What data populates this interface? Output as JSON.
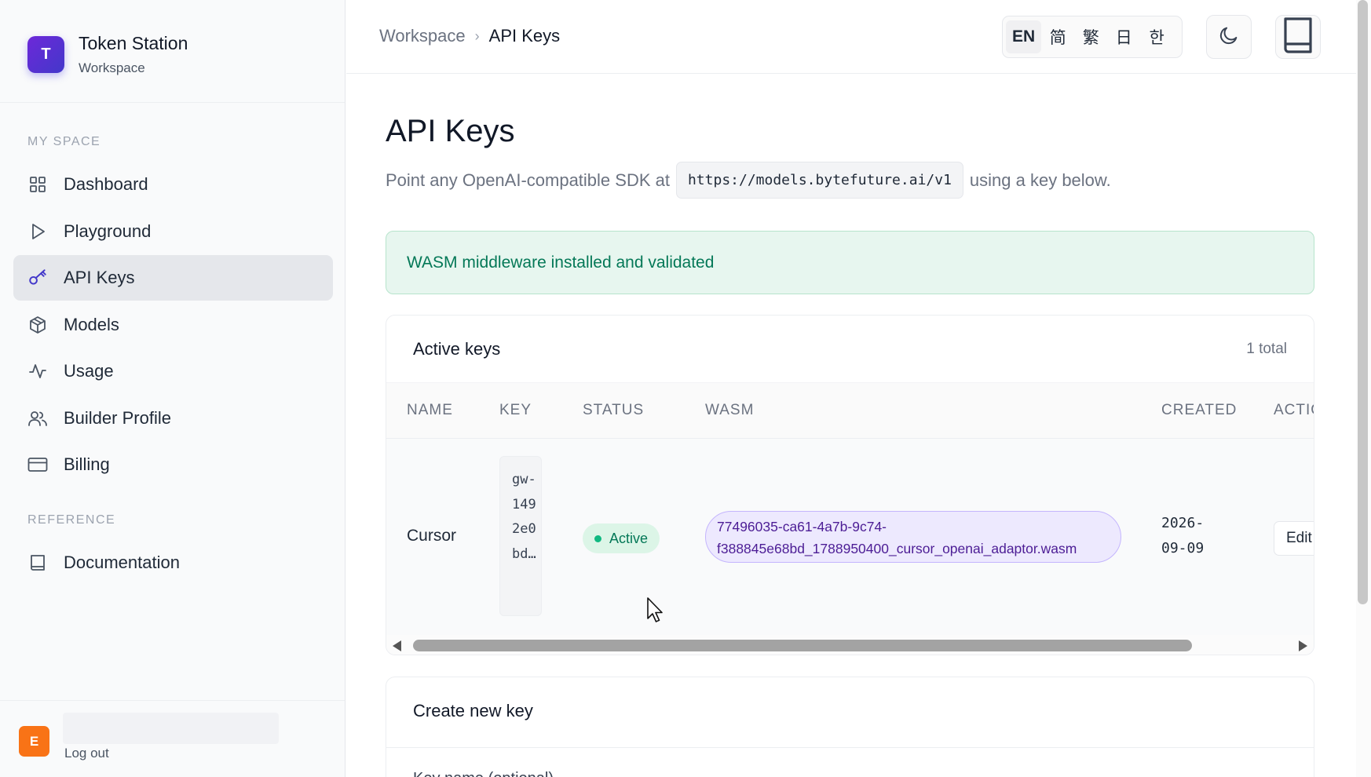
{
  "brand": {
    "logo_letter": "T",
    "name": "Token Station",
    "subtitle": "Workspace"
  },
  "sidebar": {
    "sections": [
      {
        "label": "MY SPACE"
      },
      {
        "label": "REFERENCE"
      }
    ],
    "items": [
      {
        "label": "Dashboard",
        "icon": "grid-icon",
        "active": false
      },
      {
        "label": "Playground",
        "icon": "play-icon",
        "active": false
      },
      {
        "label": "API Keys",
        "icon": "key-icon",
        "active": true
      },
      {
        "label": "Models",
        "icon": "cube-icon",
        "active": false
      },
      {
        "label": "Usage",
        "icon": "activity-icon",
        "active": false
      },
      {
        "label": "Builder Profile",
        "icon": "users-icon",
        "active": false
      },
      {
        "label": "Billing",
        "icon": "credit-card-icon",
        "active": false
      },
      {
        "label": "Documentation",
        "icon": "book-icon",
        "active": false
      }
    ],
    "user": {
      "avatar_letter": "E",
      "logout_label": "Log out"
    }
  },
  "header": {
    "breadcrumb": {
      "root": "Workspace",
      "separator": "›",
      "current": "API Keys"
    },
    "languages": [
      {
        "label": "EN",
        "active": true
      },
      {
        "label": "简",
        "active": false
      },
      {
        "label": "繁",
        "active": false
      },
      {
        "label": "日",
        "active": false
      },
      {
        "label": "한",
        "active": false
      }
    ],
    "theme_icon": "moon-icon",
    "docs_icon": "book-icon"
  },
  "main": {
    "title": "API Keys",
    "description_before": "Point any OpenAI-compatible SDK at",
    "base_url": "https://models.bytefuture.ai/v1",
    "description_after": "using a key below.",
    "alert": "WASM middleware installed and validated",
    "keys_card": {
      "title": "Active keys",
      "count": "1 total",
      "columns": [
        "NAME",
        "KEY",
        "STATUS",
        "WASM",
        "CREATED",
        "ACTIO"
      ],
      "rows": [
        {
          "name": "Cursor",
          "key": "gw-1492e0bd…",
          "status": "Active",
          "wasm": "77496035-ca61-4a7b-9c74-f388845e68bd_1788950400_cursor_openai_adaptor.wasm",
          "created_date": "2026-",
          "created_rest": "09-09",
          "action": "Edit"
        }
      ]
    },
    "create_card": {
      "title": "Create new key",
      "field_label": "Key name (optional)"
    }
  },
  "colors": {
    "accent": "#4f46e5",
    "success": "#047857",
    "wasm": "#4c1d95",
    "avatar": "#f97316"
  }
}
